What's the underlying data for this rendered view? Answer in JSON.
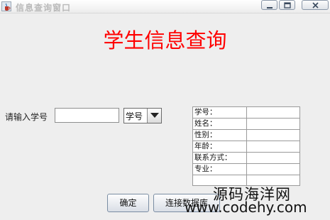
{
  "window": {
    "title": "信息查询窗口",
    "icon": "java-coffee-icon",
    "controls": [
      "minimize-icon",
      "maximize-icon",
      "close-icon"
    ]
  },
  "heading": "学生信息查询",
  "search": {
    "label": "请输入学号",
    "value": "",
    "combo_selected": "学号"
  },
  "info": {
    "rows": [
      {
        "label": "学号：",
        "value": ""
      },
      {
        "label": "姓名：",
        "value": ""
      },
      {
        "label": "性别：",
        "value": ""
      },
      {
        "label": "年龄：",
        "value": ""
      },
      {
        "label": "联系方式：",
        "value": ""
      },
      {
        "label": "专业：",
        "value": ""
      }
    ]
  },
  "buttons": {
    "confirm": "确定",
    "connect": "连接数据库"
  },
  "watermark": {
    "name": "源码海洋网",
    "url": "www.codehy.com"
  }
}
